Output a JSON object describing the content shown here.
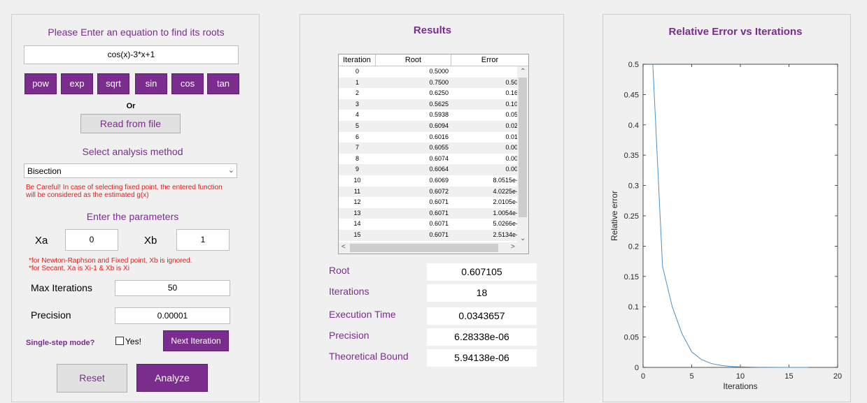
{
  "left": {
    "prompt": "Please Enter an equation to find its roots",
    "equation": "cos(x)-3*x+1",
    "fn_buttons": [
      "pow",
      "exp",
      "sqrt",
      "sin",
      "cos",
      "tan"
    ],
    "or_label": "Or",
    "read_file_label": "Read from file",
    "method_title": "Select analysis method",
    "method_selected": "Bisection",
    "warning_line1": "Be Careful! In case of selecting fixed point, the entered function",
    "warning_line2": "will be considered as the estimated g(x)",
    "params_title": "Enter the parameters",
    "xa_label": "Xa",
    "xa_value": "0",
    "xb_label": "Xb",
    "xb_value": "1",
    "note_line1": "*for Newton-Raphson and Fixed point, Xb is ignored.",
    "note_line2": "*for Secant, Xa is Xi-1 & Xb is Xi",
    "max_iter_label": "Max Iterations",
    "max_iter_value": "50",
    "precision_label": "Precision",
    "precision_value": "0.00001",
    "single_step_label": "Single-step mode?",
    "yes_label": "Yes!",
    "next_iter_label": "Next Iteration",
    "reset_label": "Reset",
    "analyze_label": "Analyze"
  },
  "results": {
    "title": "Results",
    "table": {
      "headers": [
        "Iteration",
        "Root",
        "Error"
      ],
      "rows": [
        [
          "0",
          "0.5000",
          ""
        ],
        [
          "1",
          "0.7500",
          "0.50"
        ],
        [
          "2",
          "0.6250",
          "0.16"
        ],
        [
          "3",
          "0.5625",
          "0.10"
        ],
        [
          "4",
          "0.5938",
          "0.05"
        ],
        [
          "5",
          "0.6094",
          "0.02"
        ],
        [
          "6",
          "0.6016",
          "0.01"
        ],
        [
          "7",
          "0.6055",
          "0.00"
        ],
        [
          "8",
          "0.6074",
          "0.00"
        ],
        [
          "9",
          "0.6064",
          "0.00"
        ],
        [
          "10",
          "0.6069",
          "8.0515e-"
        ],
        [
          "11",
          "0.6072",
          "4.0225e-"
        ],
        [
          "12",
          "0.6071",
          "2.0105e-"
        ],
        [
          "13",
          "0.6071",
          "1.0054e-"
        ],
        [
          "14",
          "0.6071",
          "5.0266e-"
        ],
        [
          "15",
          "0.6071",
          "2.5134e-"
        ]
      ]
    },
    "root_label": "Root",
    "root_value": "0.607105",
    "iterations_label": "Iterations",
    "iterations_value": "18",
    "exec_label": "Execution Time",
    "exec_value": "0.0343657",
    "precision_label": "Precision",
    "precision_value": "6.28338e-06",
    "bound_label": "Theoretical Bound",
    "bound_value": "5.94138e-06"
  },
  "chart_data": {
    "type": "line",
    "title": "Relative Error vs Iterations",
    "xlabel": "Iterations",
    "ylabel": "Relative error",
    "xlim": [
      0,
      20
    ],
    "ylim": [
      0,
      0.5
    ],
    "xticks": [
      0,
      5,
      10,
      15,
      20
    ],
    "yticks": [
      0,
      0.05,
      0.1,
      0.15,
      0.2,
      0.25,
      0.3,
      0.35,
      0.4,
      0.45,
      0.5
    ],
    "series": [
      {
        "color": "#4a90c8",
        "x": [
          1,
          2,
          3,
          4,
          5,
          6,
          7,
          8,
          9,
          10,
          11,
          12,
          13,
          14,
          15,
          16,
          17
        ],
        "y": [
          0.5,
          0.1667,
          0.1,
          0.0556,
          0.0256,
          0.013,
          0.0064,
          0.0032,
          0.0016,
          0.0008,
          0.0004,
          0.0002,
          0.0001,
          5e-05,
          3e-05,
          1e-05,
          6e-06
        ]
      }
    ]
  }
}
